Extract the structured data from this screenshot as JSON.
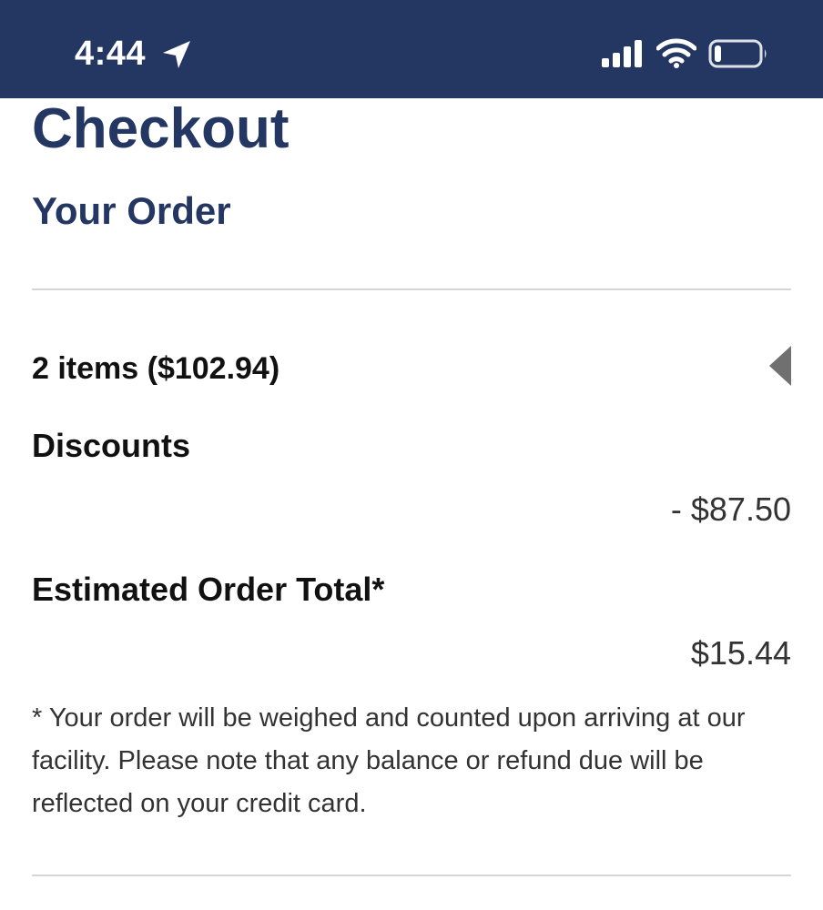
{
  "status_bar": {
    "time": "4:44",
    "location_icon": "location-arrow-icon",
    "signal_icon": "cellular-signal-icon",
    "wifi_icon": "wifi-icon",
    "battery_icon": "battery-low-icon",
    "battery_level": 0.15,
    "background_color": "#243763"
  },
  "checkout": {
    "title": "Checkout",
    "section_title": "Your Order",
    "items_summary": "2 items ($102.94)",
    "expand_icon": "caret-left-icon",
    "discounts_label": "Discounts",
    "discounts_value": "- $87.50",
    "total_label": "Estimated Order Total*",
    "total_value": "$15.44",
    "note": "* Your order will be weighed and counted upon arriving at our facility. Please note that any balance or refund due will be reflected on your credit card."
  },
  "colors": {
    "brand": "#243763",
    "text": "#111111",
    "muted_text": "#333333",
    "divider": "#d6d6d6",
    "caret": "#707070"
  }
}
